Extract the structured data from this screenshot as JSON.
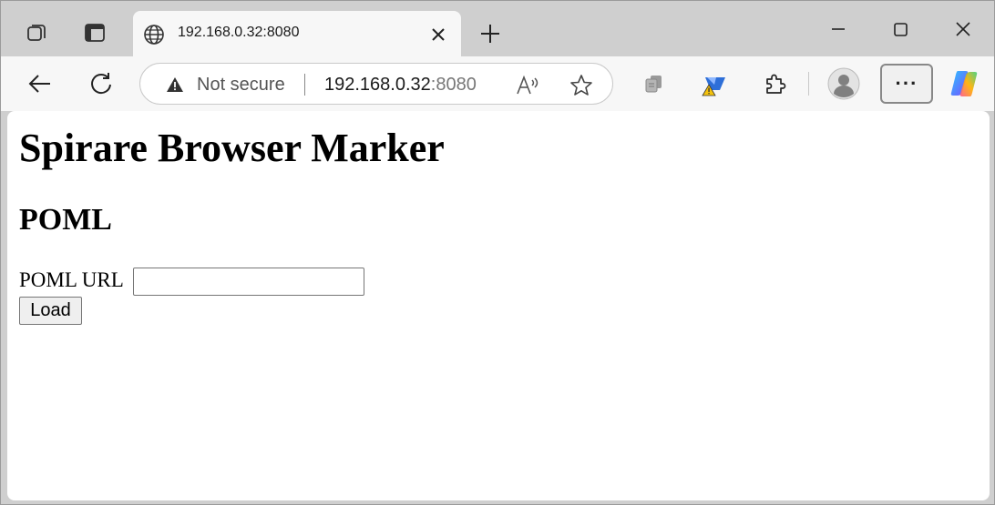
{
  "tab": {
    "title": "192.168.0.32:8080"
  },
  "address_bar": {
    "security_text": "Not secure",
    "host": "192.168.0.32",
    "port": ":8080"
  },
  "icons": {
    "workspaces": "workspaces-icon",
    "tab_actions": "tab-actions-icon",
    "globe": "globe-icon",
    "close_tab": "close-icon",
    "new_tab": "plus-icon",
    "minimize": "minimize-icon",
    "maximize": "maximize-icon",
    "close_window": "close-window-icon",
    "back": "back-arrow-icon",
    "refresh": "refresh-icon",
    "warning": "warning-icon",
    "read_aloud": "read-aloud-icon",
    "favorite": "star-icon",
    "collections": "collections-icon",
    "extension_bird": "extension-icon",
    "extensions": "puzzle-icon",
    "profile": "profile-avatar-icon",
    "menu": "more-menu-icon",
    "copilot": "copilot-icon"
  },
  "menu_label": "···",
  "page": {
    "heading": "Spirare Browser Marker",
    "subheading": "POML",
    "url_label": "POML URL",
    "url_value": "",
    "load_button": "Load"
  }
}
